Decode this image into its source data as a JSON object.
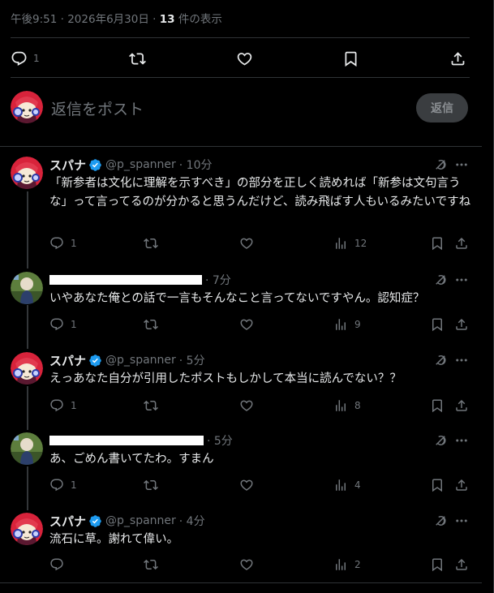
{
  "post_meta": {
    "time": "午後9:51",
    "sep": "·",
    "date": "2026年6月30日",
    "sep2": "·",
    "count": "13",
    "count_suffix": "件の表示"
  },
  "post_actions": {
    "reply_count": "1"
  },
  "compose": {
    "placeholder": "返信をポスト",
    "button": "返信"
  },
  "icons": [
    "reply-icon",
    "retweet-icon",
    "like-icon",
    "bookmark-icon",
    "share-icon",
    "views-icon",
    "grok-icon",
    "more-icon",
    "verified-badge-icon"
  ],
  "colors": {
    "background": "#000000",
    "text": "#e7e9ea",
    "muted": "#71767b",
    "border": "#2f3336",
    "verified": "#1d9bf0"
  },
  "tweets": [
    {
      "name": "スパナ",
      "handle": "@p_spanner",
      "time": "· 10分",
      "text": "「新参者は文化に理解を示すべき」の部分を正しく読めれば「新参は文句言うな」って言ってるのが分かると思うんだけど、読み飛ばす人もいるみたいですね",
      "replies": "1",
      "views": "12"
    },
    {
      "time": "· 7分",
      "text": "いやあなた俺との話で一言もそんなこと言ってないですやん。認知症？",
      "replies": "1",
      "views": "9"
    },
    {
      "name": "スパナ",
      "handle": "@p_spanner",
      "time": "· 5分",
      "text": "えっあなた自分が引用したポストもしかして本当に読んでない？？",
      "replies": "1",
      "views": "8"
    },
    {
      "time": "· 5分",
      "text": "あ、ごめん書いてたわ。すまん",
      "replies": "1",
      "views": "4"
    },
    {
      "name": "スパナ",
      "handle": "@p_spanner",
      "time": "· 4分",
      "text": "流石に草。謝れて偉い。",
      "replies": "",
      "views": "2"
    }
  ]
}
